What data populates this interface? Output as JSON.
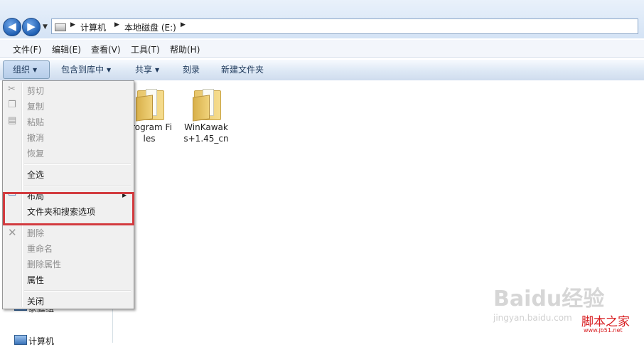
{
  "address_bar": {
    "crumbs": [
      "计算机",
      "本地磁盘 (E:)"
    ],
    "back_icon": "back-arrow-icon",
    "forward_icon": "forward-arrow-icon"
  },
  "menubar": {
    "items": [
      "文件(F)",
      "编辑(E)",
      "查看(V)",
      "工具(T)",
      "帮助(H)"
    ]
  },
  "toolbar": {
    "organize": "组织",
    "include_library": "包含到库中",
    "share": "共享",
    "burn": "刻录",
    "new_folder": "新建文件夹"
  },
  "organize_menu": {
    "cut": "剪切",
    "copy": "复制",
    "paste": "粘贴",
    "undo": "撤消",
    "redo": "恢复",
    "select_all": "全选",
    "layout": "布局",
    "folder_options": "文件夹和搜索选项",
    "delete": "删除",
    "rename": "重命名",
    "remove_properties": "删除属性",
    "properties": "属性",
    "close": "关闭"
  },
  "files": [
    {
      "name": "Program Files"
    },
    {
      "name": "WinKawaks+1.45_cn"
    }
  ],
  "navpane": {
    "homegroup": "家庭组",
    "computer": "计算机"
  },
  "watermark": {
    "baidu": "Baidu经验",
    "baidu_url": "jingyan.baidu.com",
    "site": "脚本之家",
    "site_url": "www.jb51.net"
  },
  "colors": {
    "highlight_box": "#d23b3f",
    "toolbar_text": "#1e395b",
    "watermark_red": "#d81d20"
  }
}
